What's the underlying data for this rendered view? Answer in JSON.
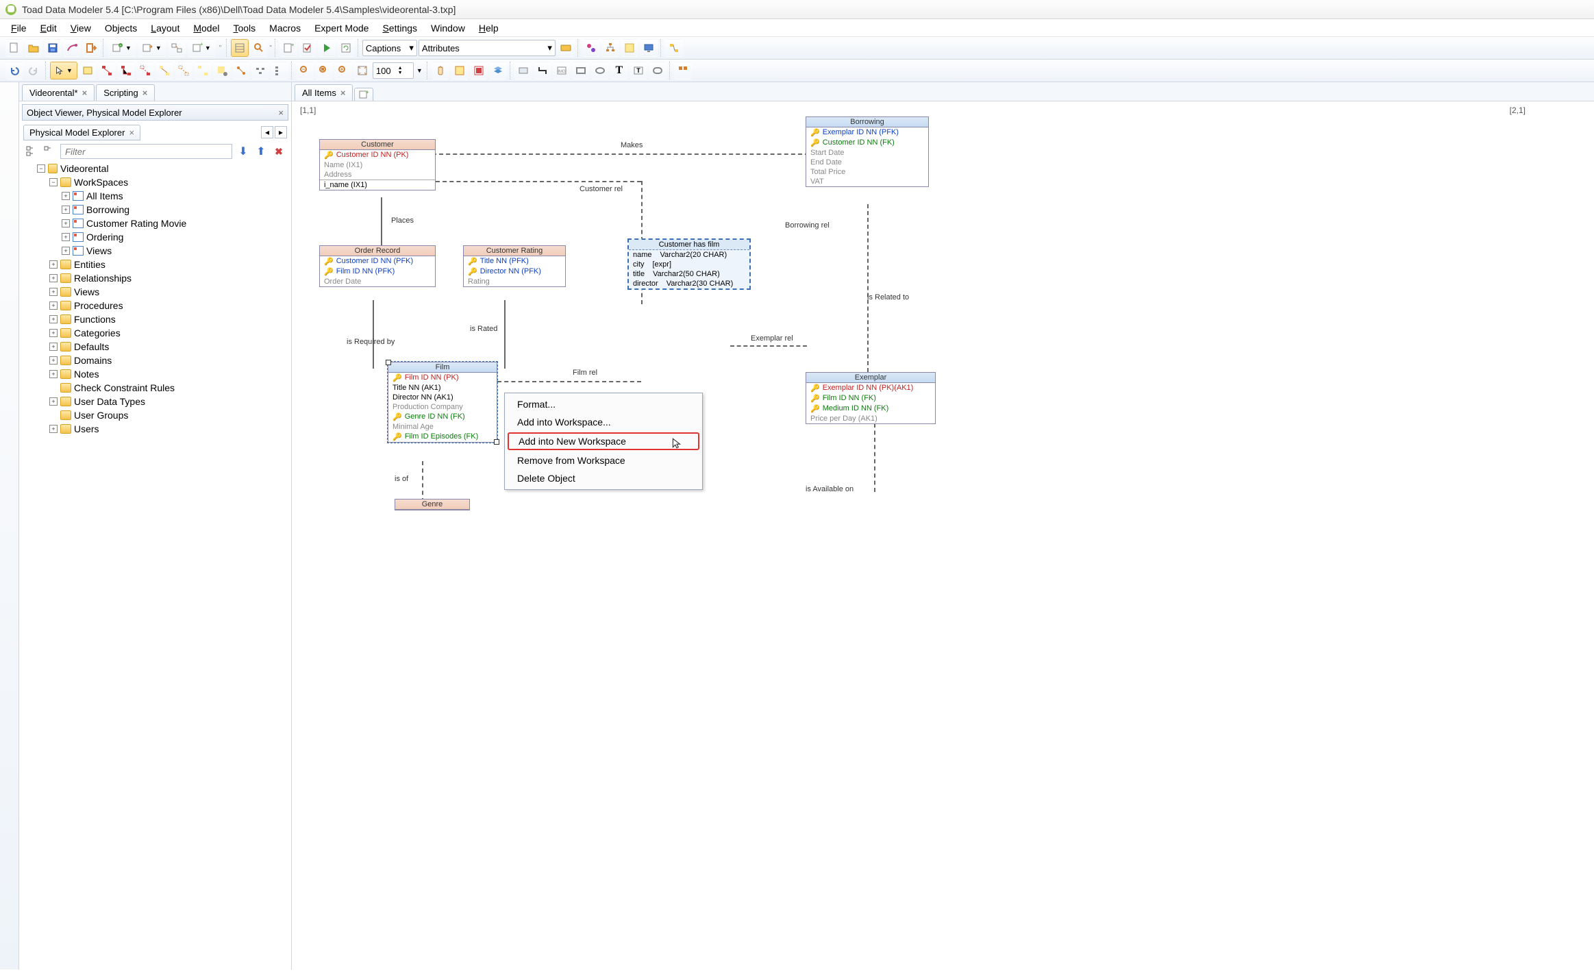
{
  "title": "Toad Data Modeler 5.4  [C:\\Program Files (x86)\\Dell\\Toad Data Modeler 5.4\\Samples\\videorental-3.txp]",
  "menu": [
    "File",
    "Edit",
    "View",
    "Objects",
    "Layout",
    "Model",
    "Tools",
    "Macros",
    "Expert Mode",
    "Settings",
    "Window",
    "Help"
  ],
  "menu_underline": [
    "F",
    "E",
    "V",
    "",
    "L",
    "M",
    "T",
    "",
    "",
    "S",
    "",
    "H"
  ],
  "toolbar1": {
    "captions_label": "Captions",
    "attributes_label": "Attributes"
  },
  "toolbar2": {
    "zoom_value": "100"
  },
  "doc_tabs": [
    {
      "label": "Videorental*"
    },
    {
      "label": "Scripting"
    }
  ],
  "panel_title": "Object Viewer, Physical Model Explorer",
  "sub_tab": "Physical Model Explorer",
  "filter_placeholder": "Filter",
  "tree": {
    "root": "Videorental",
    "workspaces_label": "WorkSpaces",
    "ws_items": [
      "All Items",
      "Borrowing",
      "Customer Rating Movie",
      "Ordering",
      "Views"
    ],
    "folders": [
      "Entities",
      "Relationships",
      "Views",
      "Procedures",
      "Functions",
      "Categories",
      "Defaults",
      "Domains",
      "Notes",
      "Check Constraint Rules",
      "User Data Types",
      "User Groups",
      "Users"
    ]
  },
  "canvas_tabs": [
    {
      "label": "All Items"
    }
  ],
  "coord_left": "[1,1]",
  "coord_right": "[2,1]",
  "entities": {
    "customer": {
      "title": "Customer",
      "rows": [
        {
          "t": "Customer ID NN  (PK)",
          "c": "pk",
          "k": 1
        },
        {
          "t": "Name  (IX1)",
          "c": "dim"
        },
        {
          "t": "Address",
          "c": "dim"
        },
        {
          "t": "i_name (IX1)",
          "c": "",
          "sep": true
        }
      ]
    },
    "order_record": {
      "title": "Order Record",
      "rows": [
        {
          "t": "Customer ID NN  (PFK)",
          "c": "pfk",
          "k": 1
        },
        {
          "t": "Film ID NN  (PFK)",
          "c": "pfk",
          "k": 1
        },
        {
          "t": "Order Date",
          "c": "dim"
        }
      ]
    },
    "customer_rating": {
      "title": "Customer Rating",
      "rows": [
        {
          "t": "Title NN  (PFK)",
          "c": "pfk",
          "k": 1
        },
        {
          "t": "Director NN  (PFK)",
          "c": "pfk",
          "k": 1
        },
        {
          "t": "Rating",
          "c": "dim"
        }
      ]
    },
    "film": {
      "title": "Film",
      "rows": [
        {
          "t": "Film ID NN  (PK)",
          "c": "pk",
          "k": 1
        },
        {
          "t": "Title NN (AK1)",
          "c": ""
        },
        {
          "t": "Director NN (AK1)",
          "c": ""
        },
        {
          "t": "Production Company",
          "c": "dim"
        },
        {
          "t": "Genre ID NN  (FK)",
          "c": "fk",
          "k": 1
        },
        {
          "t": "Minimal Age",
          "c": "dim"
        },
        {
          "t": "Film ID Episodes   (FK)",
          "c": "fk",
          "k": 1
        }
      ]
    },
    "genre": {
      "title": "Genre"
    },
    "borrowing": {
      "title": "Borrowing",
      "rows": [
        {
          "t": "Exemplar ID NN  (PFK)",
          "c": "pfk",
          "k": 1
        },
        {
          "t": "Customer ID NN  (FK)",
          "c": "fk",
          "k": 1
        },
        {
          "t": "Start Date",
          "c": "dim"
        },
        {
          "t": "End Date",
          "c": "dim"
        },
        {
          "t": "Total Price",
          "c": "dim"
        },
        {
          "t": "VAT",
          "c": "dim"
        }
      ]
    },
    "exemplar": {
      "title": "Exemplar",
      "rows": [
        {
          "t": "Exemplar ID NN  (PK)(AK1)",
          "c": "pk",
          "k": 1
        },
        {
          "t": "Film ID NN  (FK)",
          "c": "fk",
          "k": 1
        },
        {
          "t": "Medium ID NN  (FK)",
          "c": "fk",
          "k": 1
        },
        {
          "t": "Price per Day  (AK1)",
          "c": "dim"
        }
      ]
    }
  },
  "view": {
    "title": "Customer has film",
    "rows": [
      [
        "name",
        "Varchar2(20 CHAR)"
      ],
      [
        "city",
        "[expr]"
      ],
      [
        "title",
        "Varchar2(50 CHAR)"
      ],
      [
        "director",
        "Varchar2(30 CHAR)"
      ]
    ]
  },
  "rel_labels": {
    "makes": "Makes",
    "customer_rel": "Customer rel",
    "places": "Places",
    "is_required": "is Required by",
    "is_rated": "is Rated",
    "film_rel": "Film rel",
    "is_of": "is of",
    "borrowing_rel": "Borrowing rel",
    "is_related": "is Related to",
    "exemplar_rel": "Exemplar rel",
    "is_available": "is Available on"
  },
  "ctx": {
    "format": "Format...",
    "add_ws": "Add into Workspace...",
    "add_new_ws": "Add into New Workspace",
    "remove": "Remove from Workspace",
    "delete": "Delete Object"
  }
}
